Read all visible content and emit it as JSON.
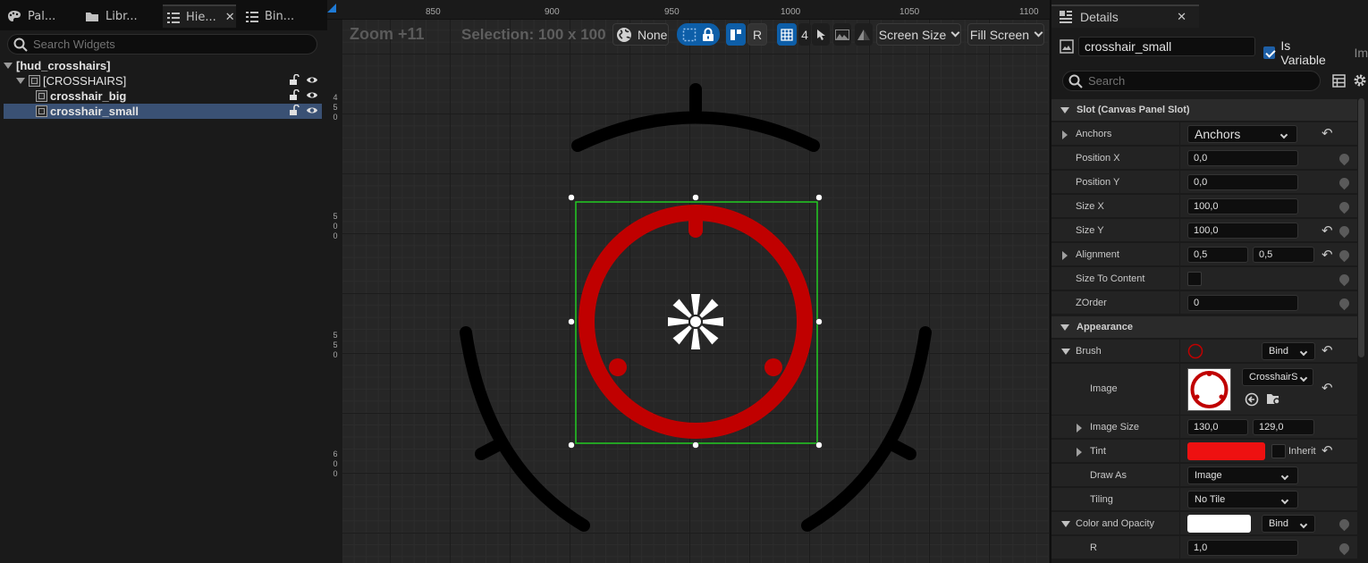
{
  "left_panel": {
    "tabs": [
      {
        "label": "Pal..."
      },
      {
        "label": "Libr..."
      },
      {
        "label": "Hie..."
      },
      {
        "label": "Bin..."
      }
    ],
    "search_placeholder": "Search Widgets",
    "tree": [
      {
        "label": "[hud_crosshairs]"
      },
      {
        "label": "[CROSSHAIRS]"
      },
      {
        "label": "crosshair_big"
      },
      {
        "label": "crosshair_small",
        "selected": true
      }
    ]
  },
  "viewport": {
    "ruler_x": [
      "850",
      "900",
      "950",
      "1000",
      "1050",
      "1100"
    ],
    "ruler_y": [
      "450",
      "500",
      "550",
      "600"
    ],
    "zoom_label": "Zoom +11",
    "selection_label": "Selection: 100 x 100",
    "toolbar": {
      "locale": "None",
      "respect_lock": "R",
      "grid_snap": "4",
      "screen_size": "Screen Size",
      "fill_screen": "Fill Screen"
    },
    "colors": {
      "crosshair_small": "#c00000",
      "crosshair_big": "#000000",
      "selection_box": "#22cc22"
    }
  },
  "details": {
    "tab_label": "Details",
    "widget_name": "crosshair_small",
    "is_variable_label": "Is Variable",
    "is_variable": true,
    "cut_label": "Im",
    "search_placeholder": "Search",
    "sections": {
      "slot": "Slot (Canvas Panel Slot)",
      "appearance": "Appearance"
    },
    "properties": {
      "anchors": {
        "label": "Anchors",
        "value": "Anchors"
      },
      "position_x": {
        "label": "Position X",
        "value": "0,0"
      },
      "position_y": {
        "label": "Position Y",
        "value": "0,0"
      },
      "size_x": {
        "label": "Size X",
        "value": "100,0"
      },
      "size_y": {
        "label": "Size Y",
        "value": "100,0"
      },
      "alignment": {
        "label": "Alignment",
        "x": "0,5",
        "y": "0,5"
      },
      "size_to_content": {
        "label": "Size To Content"
      },
      "zorder": {
        "label": "ZOrder",
        "value": "0"
      },
      "brush": {
        "label": "Brush",
        "bind": "Bind"
      },
      "image": {
        "label": "Image",
        "asset": "CrosshairS"
      },
      "image_size": {
        "label": "Image Size",
        "x": "130,0",
        "y": "129,0"
      },
      "tint": {
        "label": "Tint",
        "color": "#ee1111",
        "inherit": "Inherit"
      },
      "draw_as": {
        "label": "Draw As",
        "value": "Image"
      },
      "tiling": {
        "label": "Tiling",
        "value": "No Tile"
      },
      "color_opacity": {
        "label": "Color and Opacity",
        "bind": "Bind",
        "color": "#ffffff"
      },
      "r": {
        "label": "R",
        "value": "1,0"
      }
    }
  }
}
